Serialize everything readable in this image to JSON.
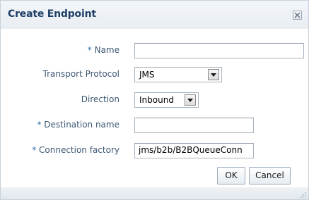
{
  "dialog": {
    "title": "Create Endpoint"
  },
  "form": {
    "required_marker": "*",
    "name": {
      "label": "Name",
      "value": ""
    },
    "transport_protocol": {
      "label": "Transport Protocol",
      "value": "JMS"
    },
    "direction": {
      "label": "Direction",
      "value": "Inbound"
    },
    "destination_name": {
      "label": "Destination name",
      "value": ""
    },
    "connection_factory": {
      "label": "Connection factory",
      "value": "jms/b2b/B2BQueueConn"
    }
  },
  "buttons": {
    "ok": "OK",
    "cancel": "Cancel"
  },
  "icons": {
    "close": "close-icon",
    "dropdown": "chevron-down-icon",
    "resize": "resize-grip-icon"
  },
  "colors": {
    "title": "#1f3f67",
    "label": "#3d5873",
    "required": "#2b6bb0"
  }
}
